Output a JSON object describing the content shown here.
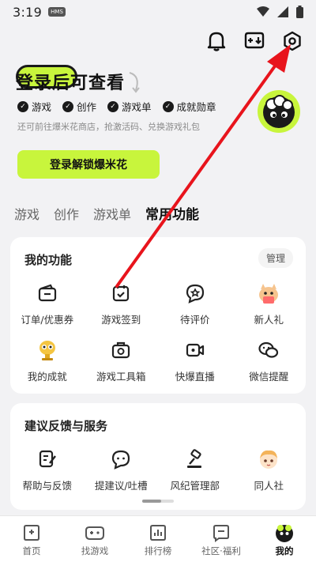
{
  "status_bar": {
    "time": "3:19",
    "badge": "HMS"
  },
  "hero": {
    "title": "登录后可查看",
    "badges": [
      "游戏",
      "创作",
      "游戏单",
      "成就勋章"
    ],
    "subtitle": "还可前往爆米花商店，抢激活码、兑换游戏礼包",
    "login_button": "登录解锁爆米花"
  },
  "tabs": [
    "游戏",
    "创作",
    "游戏单",
    "常用功能"
  ],
  "my_functions": {
    "title": "我的功能",
    "manage_label": "管理",
    "items": [
      {
        "label": "订单/优惠券",
        "icon": "wallet-icon"
      },
      {
        "label": "游戏签到",
        "icon": "calendar-check-icon"
      },
      {
        "label": "待评价",
        "icon": "chat-star-icon"
      },
      {
        "label": "新人礼",
        "icon": "mascot-gift-icon"
      },
      {
        "label": "我的成就",
        "icon": "trophy-mascot-icon"
      },
      {
        "label": "游戏工具箱",
        "icon": "toolbox-icon"
      },
      {
        "label": "快爆直播",
        "icon": "video-camera-icon"
      },
      {
        "label": "微信提醒",
        "icon": "wechat-icon"
      }
    ]
  },
  "feedback": {
    "title": "建议反馈与服务",
    "items": [
      {
        "label": "帮助与反馈",
        "icon": "edit-note-icon"
      },
      {
        "label": "提建议/吐槽",
        "icon": "chat-bubble-icon"
      },
      {
        "label": "风纪管理部",
        "icon": "gavel-icon"
      },
      {
        "label": "同人社",
        "icon": "anime-avatar-icon"
      }
    ]
  },
  "bottom_nav": [
    {
      "label": "首页",
      "icon": "home-icon"
    },
    {
      "label": "找游戏",
      "icon": "gamepad-icon"
    },
    {
      "label": "排行榜",
      "icon": "rank-icon"
    },
    {
      "label": "社区·福利",
      "icon": "community-icon"
    },
    {
      "label": "我的",
      "icon": "profile-icon"
    }
  ],
  "colors": {
    "accent": "#c8f53c",
    "arrow": "#e8141c",
    "background": "#f2f2f4"
  }
}
